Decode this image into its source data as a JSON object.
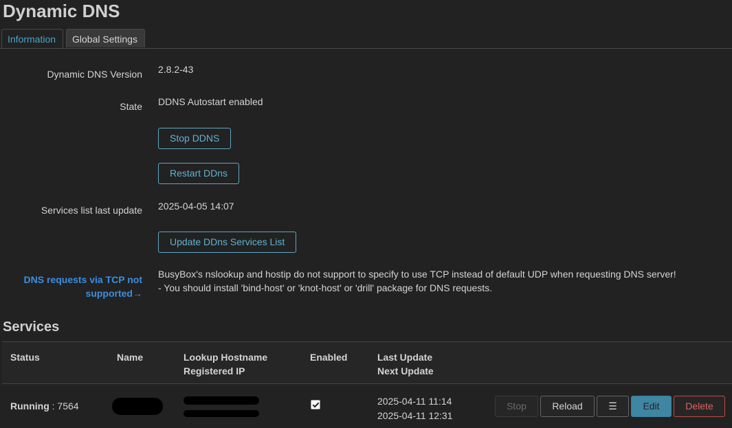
{
  "page": {
    "title": "Dynamic DNS"
  },
  "tabs": [
    {
      "label": "Information"
    },
    {
      "label": "Global Settings"
    }
  ],
  "info": {
    "version_label": "Dynamic DNS Version",
    "version_value": "2.8.2-43",
    "state_label": "State",
    "state_value": "DDNS Autostart enabled",
    "stop_ddns_button": "Stop DDNS",
    "restart_ddns_button": "Restart DDns",
    "services_update_label": "Services list last update",
    "services_update_value": "2025-04-05 14:07",
    "update_services_button": "Update DDns Services List",
    "tcp_warning_label": "DNS requests via TCP not supported→",
    "tcp_warning_line1": "BusyBox's nslookup and hostip do not support to specify to use TCP instead of default UDP when requesting DNS server!",
    "tcp_warning_line2": "- You should install 'bind-host' or 'knot-host' or 'drill' package for DNS requests."
  },
  "services": {
    "title": "Services",
    "columns": {
      "status": "Status",
      "name": "Name",
      "lookup_hostname": "Lookup Hostname",
      "registered_ip": "Registered IP",
      "enabled": "Enabled",
      "last_update": "Last Update",
      "next_update": "Next Update"
    },
    "rows": [
      {
        "status": "Running",
        "pid": " : 7564",
        "enabled": true,
        "last_update": "2025-04-11 11:14",
        "next_update": "2025-04-11 12:31",
        "actions": {
          "stop": "Stop",
          "reload": "Reload",
          "menu": "☰",
          "edit": "Edit",
          "delete": "Delete"
        }
      }
    ]
  }
}
